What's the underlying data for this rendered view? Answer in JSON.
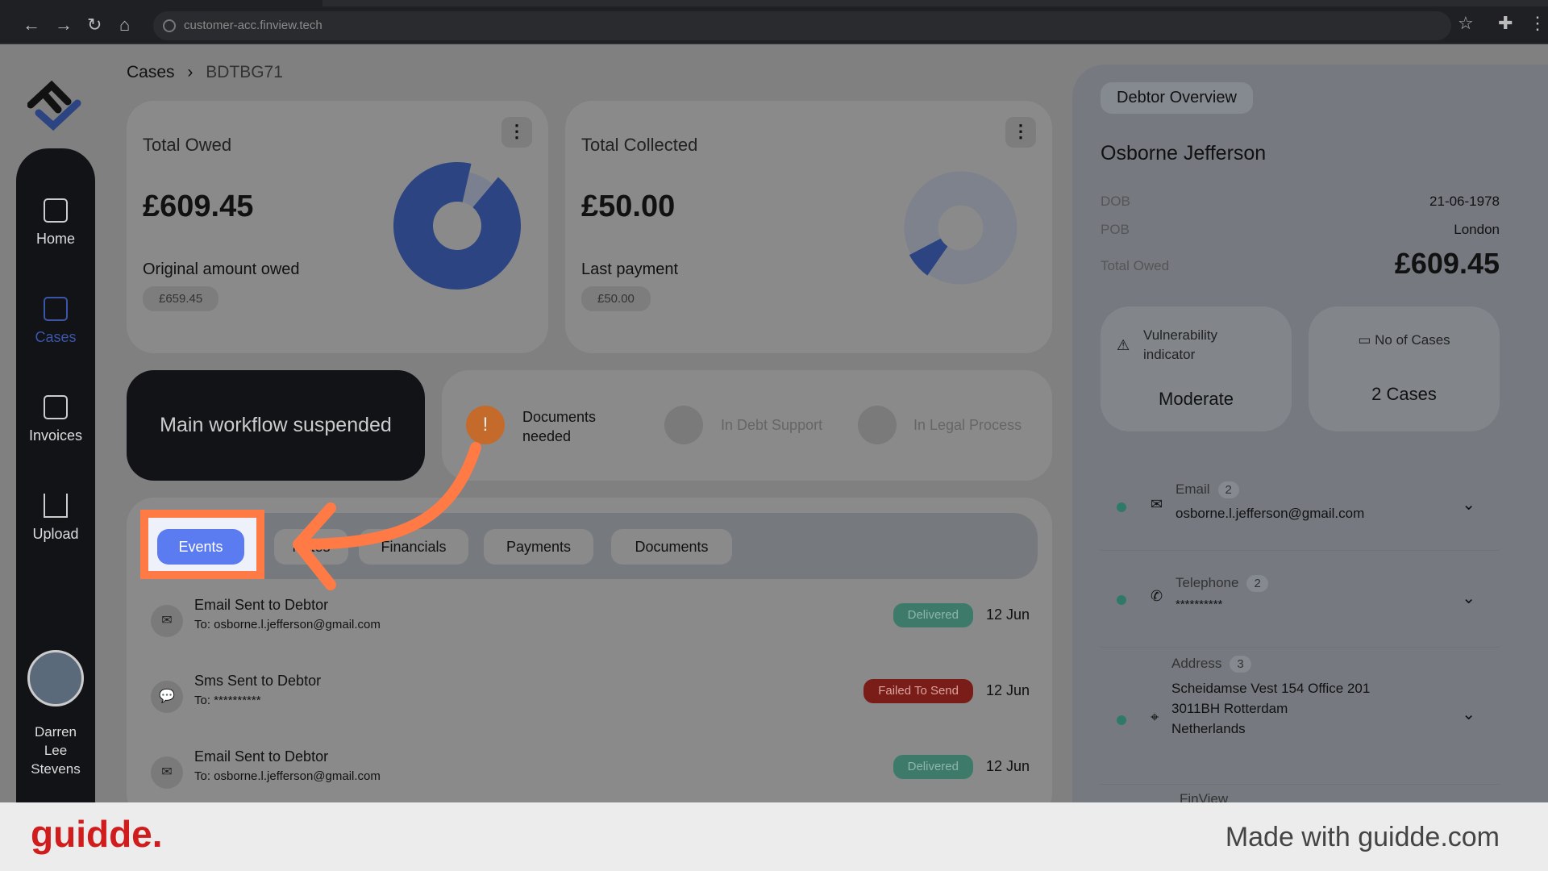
{
  "browser": {
    "url": "customer-acc.finview.tech"
  },
  "sidebar": {
    "items": [
      {
        "label": "Home",
        "icon": "home-icon"
      },
      {
        "label": "Cases",
        "icon": "id-card-icon",
        "active": true
      },
      {
        "label": "Invoices",
        "icon": "document-icon"
      },
      {
        "label": "Upload",
        "icon": "upload-icon"
      }
    ],
    "user": {
      "line1": "Darren",
      "line2": "Lee",
      "line3": "Stevens"
    }
  },
  "breadcrumb": {
    "root": "Cases",
    "current": "BDTBG71"
  },
  "total_owed": {
    "title": "Total Owed",
    "amount": "£609.45",
    "sub_label": "Original amount owed",
    "sub_value": "£659.45",
    "chart": {
      "type": "pie",
      "values": [
        609.45,
        50.0
      ]
    }
  },
  "total_collected": {
    "title": "Total Collected",
    "amount": "£50.00",
    "sub_label": "Last payment",
    "sub_value": "£50.00",
    "chart": {
      "type": "pie",
      "values": [
        50.0,
        609.45
      ]
    }
  },
  "workflow": {
    "status": "Main workflow suspended",
    "steps": [
      {
        "label": "Documents needed",
        "state": "active"
      },
      {
        "label": "In Debt Support",
        "state": "inactive"
      },
      {
        "label": "In Legal Process",
        "state": "inactive"
      }
    ]
  },
  "tabs": [
    "Events",
    "Notes",
    "Financials",
    "Payments",
    "Documents"
  ],
  "events": [
    {
      "title": "Email Sent to Debtor",
      "sub": "To: osborne.l.jefferson@gmail.com",
      "status": "Delivered",
      "date": "12 Jun",
      "icon": "mail-icon"
    },
    {
      "title": "Sms Sent to Debtor",
      "sub": "To: **********",
      "status": "Failed To Send",
      "date": "12 Jun",
      "icon": "sms-icon"
    },
    {
      "title": "Email Sent to Debtor",
      "sub": "To: osborne.l.jefferson@gmail.com",
      "status": "Delivered",
      "date": "12 Jun",
      "icon": "mail-icon"
    }
  ],
  "debtor": {
    "header": "Debtor Overview",
    "name": "Osborne Jefferson",
    "dob_label": "DOB",
    "dob": "21-06-1978",
    "pob_label": "POB",
    "pob": "London",
    "owed_label": "Total Owed",
    "owed": "£609.45",
    "vulnerability_label": "Vulnerability indicator",
    "vulnerability": "Moderate",
    "cases_label": "No of Cases",
    "cases": "2 Cases",
    "contacts": [
      {
        "label": "Email",
        "count": "2",
        "value": "osborne.l.jefferson@gmail.com"
      },
      {
        "label": "Telephone",
        "count": "2",
        "value": "**********"
      },
      {
        "label": "Address",
        "count": "3",
        "value1": "Scheidamse Vest 154 Office 201",
        "value2": "3011BH Rotterdam",
        "value3": "Netherlands"
      },
      {
        "label": "FinView"
      }
    ]
  },
  "footer": {
    "brand": "guidde.",
    "tagline": "Made with guidde.com"
  },
  "colors": {
    "accent": "#5b7cf0",
    "chart_blue": "#2c4482",
    "delivered": "#3d7a6a",
    "failed": "#7a1c18",
    "highlight": "#ff7a45",
    "warning": "#c46a2a"
  }
}
